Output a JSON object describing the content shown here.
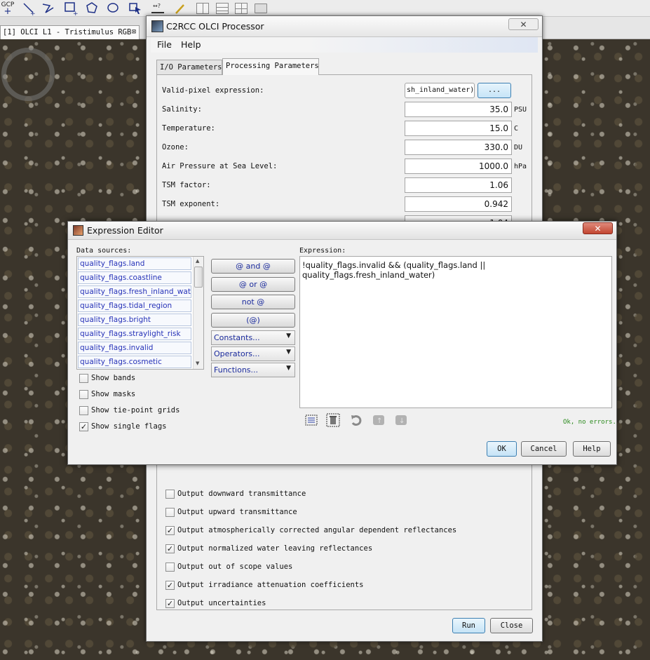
{
  "toolbar": {
    "gcp_label": "GCP",
    "icons": [
      "gcp-add-icon",
      "line-tool-icon",
      "polyline-tool-icon",
      "rectangle-tool-icon",
      "polygon-tool-icon",
      "ellipse-tool-icon",
      "select-tool-icon",
      "range-finder-icon",
      "magic-wand-icon",
      "tile-vertical-icon",
      "tile-horizontal-icon",
      "tile-grid-icon",
      "folder-icon"
    ]
  },
  "doc_tab": {
    "label": "[1] OLCI L1 - Tristimulus RGB"
  },
  "c2rcc": {
    "title": "C2RCC OLCI Processor",
    "menu": {
      "file": "File",
      "help": "Help"
    },
    "tabs": {
      "io": "I/O Parameters",
      "processing": "Processing Parameters"
    },
    "params": {
      "valid_pixel": {
        "label": "Valid-pixel expression:",
        "value": "sh_inland_water)",
        "browse": "..."
      },
      "salinity": {
        "label": "Salinity:",
        "value": "35.0",
        "unit": "PSU"
      },
      "temperature": {
        "label": "Temperature:",
        "value": "15.0",
        "unit": "C"
      },
      "ozone": {
        "label": "Ozone:",
        "value": "330.0",
        "unit": "DU"
      },
      "air_pressure": {
        "label": "Air Pressure at Sea Level:",
        "value": "1000.0",
        "unit": "hPa"
      },
      "tsm_factor": {
        "label": "TSM factor:",
        "value": "1.06"
      },
      "tsm_exponent": {
        "label": "TSM exponent:",
        "value": "0.942"
      },
      "partial_value": "1.04"
    },
    "outputs": [
      {
        "label": "Output downward transmittance",
        "checked": false
      },
      {
        "label": "Output upward transmittance",
        "checked": false
      },
      {
        "label": "Output atmospherically corrected angular dependent reflectances",
        "checked": true
      },
      {
        "label": "Output normalized water leaving reflectances",
        "checked": true
      },
      {
        "label": "Output out of scope values",
        "checked": false
      },
      {
        "label": "Output irradiance attenuation coefficients",
        "checked": true
      },
      {
        "label": "Output uncertainties",
        "checked": true
      }
    ],
    "buttons": {
      "run": "Run",
      "close": "Close"
    },
    "close_glyph": "✕"
  },
  "expr_editor": {
    "title": "Expression Editor",
    "close_glyph": "✕",
    "data_sources_label": "Data sources:",
    "data_sources": [
      "quality_flags.land",
      "quality_flags.coastline",
      "quality_flags.fresh_inland_water",
      "quality_flags.tidal_region",
      "quality_flags.bright",
      "quality_flags.straylight_risk",
      "quality_flags.invalid",
      "quality_flags.cosmetic"
    ],
    "operators": {
      "and": "@ and @",
      "or": "@ or @",
      "not": "not @",
      "paren": "(@)"
    },
    "dropdowns": {
      "constants": "Constants...",
      "operators": "Operators...",
      "functions": "Functions..."
    },
    "options": [
      {
        "label": "Show bands",
        "checked": false
      },
      {
        "label": "Show masks",
        "checked": false
      },
      {
        "label": "Show tie-point grids",
        "checked": false
      },
      {
        "label": "Show single flags",
        "checked": true
      }
    ],
    "expression_label": "Expression:",
    "expression": "!quality_flags.invalid && (quality_flags.land || quality_flags.fresh_inland_water)",
    "status": "Ok, no errors.",
    "buttons": {
      "ok": "OK",
      "cancel": "Cancel",
      "help": "Help"
    }
  }
}
